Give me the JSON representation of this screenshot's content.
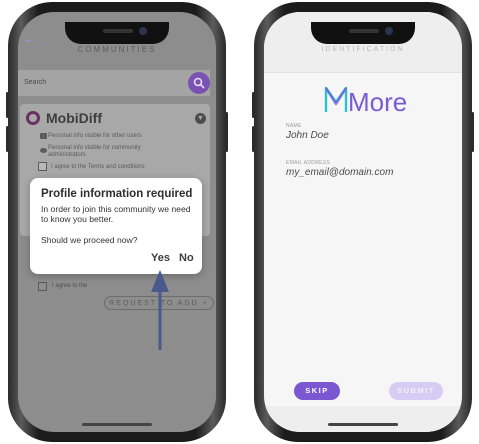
{
  "left_screen": {
    "header_title": "COMMUNITIES",
    "search_placeholder": "Search",
    "community": {
      "name": "MobiDiff",
      "options": [
        "Personal info visible for other users",
        "Personal info visible for community administrators",
        "I agree to the Terms and conditions"
      ],
      "agree_label": "I agree to the",
      "request_button": "REQUEST TO ADD +"
    },
    "dialog": {
      "title": "Profile information required",
      "body": "In order to join this community we need to know you better.",
      "question": "Should we proceed now?",
      "yes_label": "Yes",
      "no_label": "No"
    }
  },
  "right_screen": {
    "header_title": "IDENTIFICATION",
    "logo_text": "More",
    "name_label": "NAME",
    "name_value": "John Doe",
    "email_label": "EMAIL ADDRESS",
    "email_value": "my_email@domain.com",
    "skip_label": "SKIP",
    "submit_label": "SUBMIT"
  },
  "colors": {
    "accent": "#7b57d1",
    "accent_light": "#d7ccf3",
    "logo_teal": "#28c3cf",
    "logo_purple": "#7a5bd6",
    "overlay_gray": "#8d8d8d",
    "arrow_blue": "#4a5a8c"
  },
  "icons": [
    "back-arrow-icon",
    "search-icon",
    "chevron-down-icon",
    "id-card-icon",
    "eye-icon",
    "checkbox-icon",
    "up-arrow-icon"
  ]
}
